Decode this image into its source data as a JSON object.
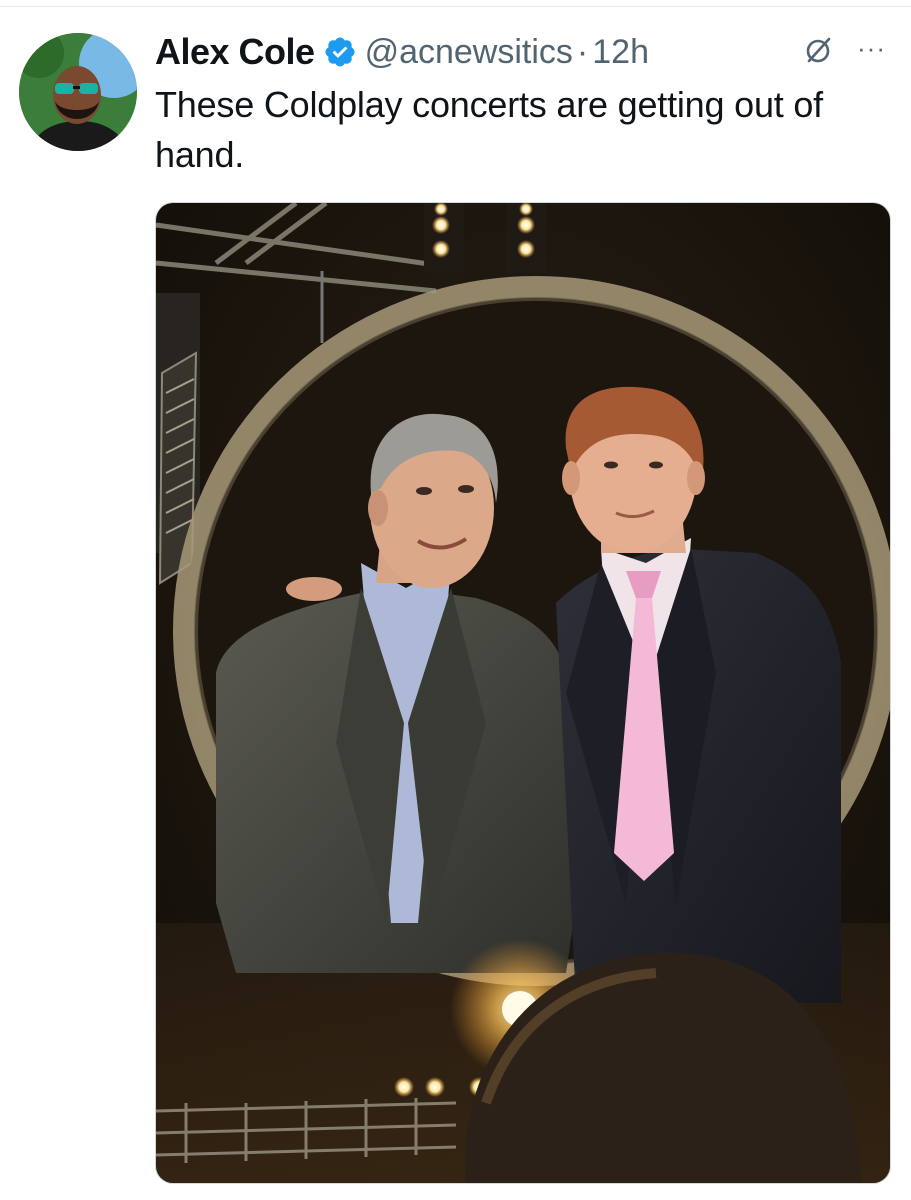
{
  "tweet": {
    "author_name": "Alex Cole",
    "handle": "@acnewsitics",
    "separator": "·",
    "time": "12h",
    "text": "These Coldplay concerts are getting out of hand.",
    "verified": true,
    "avatar_icon": "user-avatar-photo",
    "verified_icon": "verified-badge-icon",
    "grok_icon": "grok-icon",
    "more_icon": "more-options-icon",
    "more_label": "···"
  },
  "media": {
    "image_icon": "attached-photo",
    "colors": {
      "background": "#1a140d",
      "ring": "#b8a888",
      "light": "#ffe9a8",
      "tie": "#f4b9d6",
      "shirt_left": "#aeb9d8",
      "jacket_left": "#4b4b45",
      "jacket_right": "#272830"
    }
  },
  "colors": {
    "text_primary": "#0f1419",
    "text_secondary": "#536471",
    "verified_blue": "#1d9bf0"
  }
}
